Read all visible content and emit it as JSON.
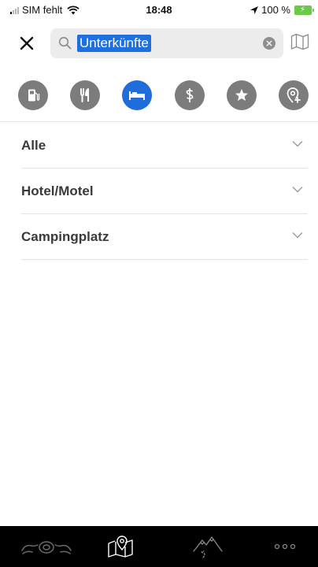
{
  "status_bar": {
    "carrier": "SIM fehlt",
    "time": "18:48",
    "battery": "100 %",
    "icons": [
      "signal-icon",
      "wifi-icon",
      "location-arrow-icon",
      "battery-icon"
    ]
  },
  "search": {
    "value": "Unterkünfte",
    "icons": [
      "close-icon",
      "search-icon",
      "clear-icon",
      "map-icon"
    ]
  },
  "categories": [
    {
      "icon": "fuel-icon",
      "active": false
    },
    {
      "icon": "restaurant-icon",
      "active": false
    },
    {
      "icon": "bed-icon",
      "active": true
    },
    {
      "icon": "medical-icon",
      "active": false
    },
    {
      "icon": "star-icon",
      "active": false
    },
    {
      "icon": "add-location-icon",
      "active": false
    }
  ],
  "filters": [
    {
      "label": "Alle"
    },
    {
      "label": "Hotel/Motel"
    },
    {
      "label": "Campingplatz"
    }
  ],
  "tab_bar": {
    "tabs": [
      "motorcycle-icon",
      "map-pin-icon",
      "mountain-route-icon",
      "more-icon"
    ]
  },
  "colors": {
    "accent": "#1f6ddb",
    "category_inactive": "#7c7c7c",
    "search_bg": "#ececec",
    "tab_bar_bg": "#000000",
    "battery": "#6bc94a"
  }
}
